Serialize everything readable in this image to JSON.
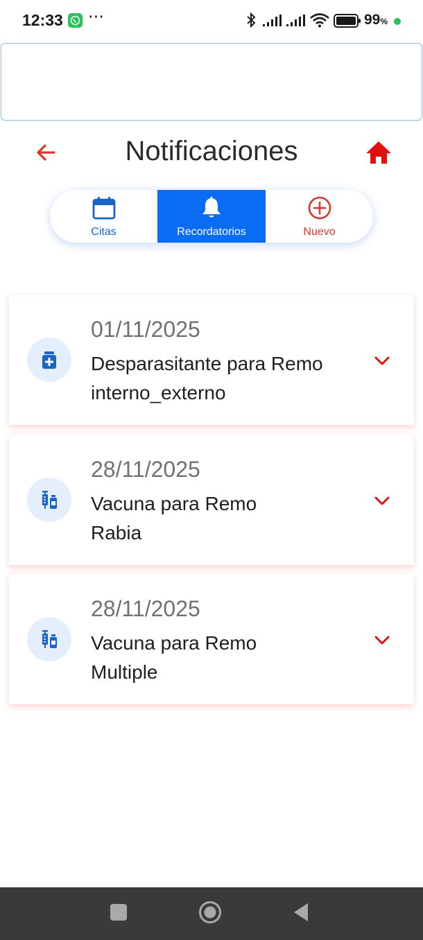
{
  "status_bar": {
    "time": "12:33",
    "more": "···",
    "battery_value": "99",
    "battery_unit": "%",
    "icons": [
      "whatsapp-icon",
      "bluetooth-icon",
      "signal-icon",
      "signal-icon",
      "wifi-icon",
      "battery-icon"
    ]
  },
  "header": {
    "title": "Notificaciones",
    "back_icon": "arrow-left-icon",
    "home_icon": "home-icon"
  },
  "tabs": [
    {
      "label": "Citas",
      "icon": "calendar-icon",
      "active": false
    },
    {
      "label": "Recordatorios",
      "icon": "bell-icon",
      "active": true
    },
    {
      "label": "Nuevo",
      "icon": "plus-circle-icon",
      "active": false
    }
  ],
  "reminders": [
    {
      "date": "01/11/2025",
      "title": "Desparasitante para Remo",
      "detail": "interno_externo",
      "icon": "medicine-bottle-icon"
    },
    {
      "date": "28/11/2025",
      "title": "Vacuna para Remo",
      "detail": "Rabia",
      "icon": "syringe-vial-icon"
    },
    {
      "date": "28/11/2025",
      "title": "Vacuna para Remo",
      "detail": "Multiple",
      "icon": "syringe-vial-icon"
    }
  ],
  "colors": {
    "accent_blue": "#0a6cf5",
    "accent_red": "#e0332b",
    "icon_bg": "#e4eefc"
  }
}
